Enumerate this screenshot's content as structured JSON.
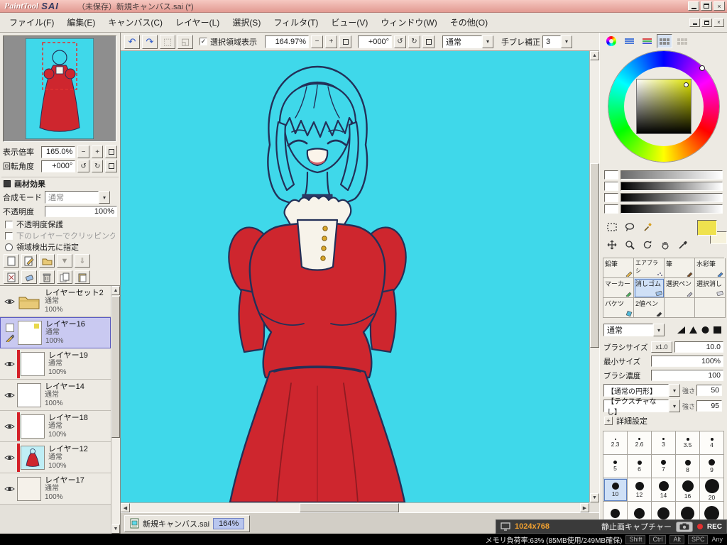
{
  "window": {
    "logo_paint": "PaintTool",
    "logo_sai": "SAI",
    "title": "（未保存）新規キャンバス.sai (*)"
  },
  "menu": {
    "items": [
      "ファイル(F)",
      "編集(E)",
      "キャンバス(C)",
      "レイヤー(L)",
      "選択(S)",
      "フィルタ(T)",
      "ビュー(V)",
      "ウィンドウ(W)",
      "その他(O)"
    ]
  },
  "toolbar": {
    "show_selection": "選択領域表示",
    "zoom": "164.97%",
    "angle": "+000°",
    "paint_mode": "通常",
    "stabilizer_label": "手ブレ補正",
    "stabilizer": "3"
  },
  "navigator": {
    "zoom_label": "表示倍率",
    "zoom": "165.0%",
    "angle_label": "回転角度",
    "angle": "+000°"
  },
  "layer_panel": {
    "effect_header": "画材効果",
    "blend_label": "合成モード",
    "blend": "通常",
    "opacity_label": "不透明度",
    "opacity": "100%",
    "opt_preserve": "不透明度保護",
    "opt_clip": "下のレイヤーでクリッピング",
    "opt_source": "領域検出元に指定",
    "items": [
      {
        "name": "レイヤーセット2",
        "mode": "通常",
        "opacity": "100%"
      },
      {
        "name": "レイヤー16",
        "mode": "通常",
        "opacity": "100%"
      },
      {
        "name": "レイヤー19",
        "mode": "通常",
        "opacity": "100%"
      },
      {
        "name": "レイヤー14",
        "mode": "通常",
        "opacity": "100%"
      },
      {
        "name": "レイヤー18",
        "mode": "通常",
        "opacity": "100%"
      },
      {
        "name": "レイヤー12",
        "mode": "通常",
        "opacity": "100%"
      },
      {
        "name": "レイヤー17",
        "mode": "通常",
        "opacity": "100%"
      }
    ]
  },
  "tools": {
    "cells": [
      "鉛筆",
      "エアブラシ",
      "筆",
      "水彩筆",
      "マーカー",
      "消しゴム",
      "選択ペン",
      "選択消し",
      "バケツ",
      "2値ペン"
    ],
    "selected": "消しゴム"
  },
  "brush": {
    "mode": "通常",
    "size_label": "ブラシサイズ",
    "size_scale": "x1.0",
    "size": "10.0",
    "min_label": "最小サイズ",
    "min": "100%",
    "density_label": "ブラシ濃度",
    "density": "100",
    "shape": "【通常の円形】",
    "shape_strength_label": "強さ",
    "shape_strength": "50",
    "texture": "【テクスチャなし】",
    "texture_strength_label": "強さ",
    "texture_strength": "95",
    "advanced": "詳細設定"
  },
  "sizes": {
    "rows": [
      [
        "2.3",
        "2.6",
        "3",
        "3.5",
        "4"
      ],
      [
        "5",
        "6",
        "7",
        "8",
        "9"
      ],
      [
        "10",
        "12",
        "14",
        "16",
        "20"
      ]
    ],
    "selected": "10"
  },
  "statusbar": {
    "tab": "新規キャンバス.sai",
    "tab_zoom": "164%",
    "memory": "メモリ負荷率:63% (85MB使用/249MB確保)",
    "mods": [
      "Shift",
      "Ctrl",
      "Alt",
      "SPC"
    ],
    "extra": "Any"
  },
  "capture": {
    "resolution": "1024x768",
    "label": "静止画キャプチャー",
    "rec": "REC"
  }
}
